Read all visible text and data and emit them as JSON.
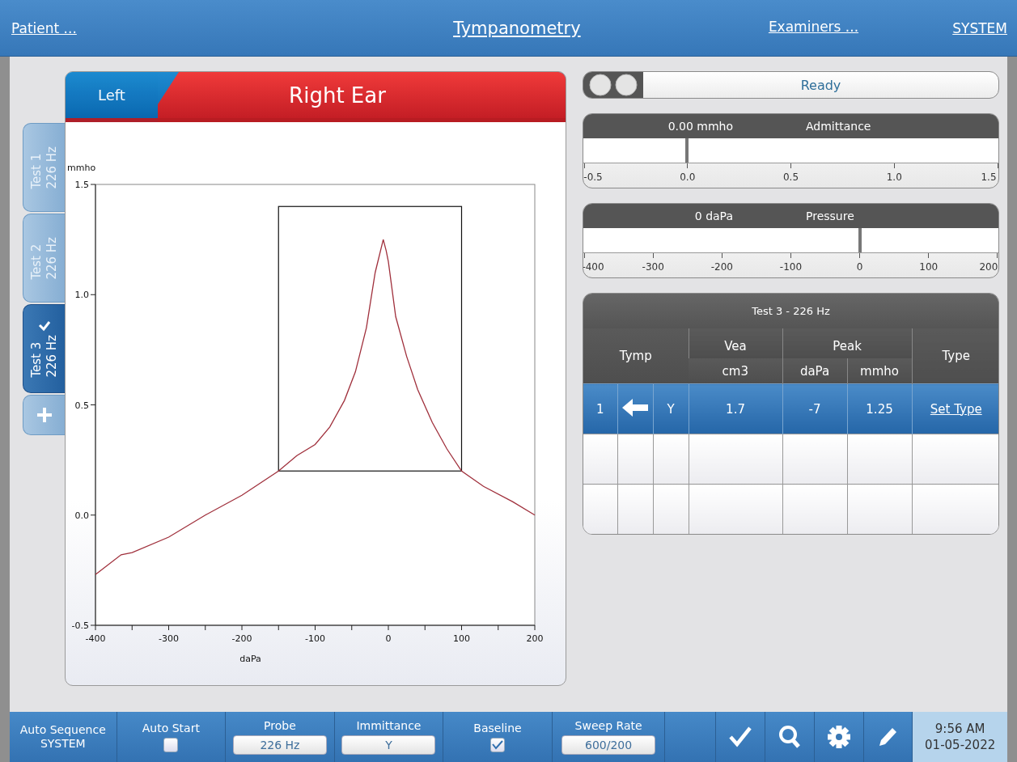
{
  "header": {
    "links": [
      {
        "label": "Patient ...",
        "kind": "side"
      },
      {
        "label": "Tympanometry",
        "kind": "title"
      },
      {
        "label": "Examiners ...",
        "kind": "side"
      },
      {
        "label": "SYSTEM",
        "kind": "side"
      }
    ]
  },
  "ear_tabs": [
    {
      "label": "Left",
      "selected": false
    },
    {
      "label": "Right Ear",
      "selected": true
    }
  ],
  "test_tabs": [
    {
      "label": "Test 1",
      "sublabel": "226 Hz",
      "selected": false,
      "checked": false
    },
    {
      "label": "Test 2",
      "sublabel": "226 Hz",
      "selected": false,
      "checked": false
    },
    {
      "label": "Test 3",
      "sublabel": "226 Hz",
      "selected": true,
      "checked": true
    }
  ],
  "graph": {
    "chart_data": {
      "type": "line",
      "xlabel": "daPa",
      "ylabel": "mmho",
      "xlim": [
        -400,
        200
      ],
      "ylim": [
        -0.5,
        1.5
      ],
      "xticks": [
        -400,
        -300,
        -200,
        -100,
        0,
        100,
        200
      ],
      "yticks": [
        {
          "value": -0.5,
          "label": "-0.5"
        },
        {
          "value": 0,
          "label": "0.0"
        },
        {
          "value": 0.5,
          "label": "0.5"
        },
        {
          "value": 1,
          "label": "1.0"
        },
        {
          "value": 1.5,
          "label": "1.5"
        }
      ],
      "x": [
        -400,
        -365,
        -350,
        -300,
        -250,
        -200,
        -150,
        -125,
        -100,
        -80,
        -60,
        -45,
        -30,
        -18,
        -7,
        -3,
        0,
        10,
        25,
        40,
        60,
        80,
        100,
        130,
        170,
        200
      ],
      "series": [
        {
          "color": "#a0303c",
          "values": [
            -0.27,
            -0.18,
            -0.17,
            -0.1,
            0.0,
            0.09,
            0.2,
            0.27,
            0.32,
            0.4,
            0.52,
            0.65,
            0.85,
            1.1,
            1.25,
            1.2,
            1.15,
            0.9,
            0.72,
            0.57,
            0.42,
            0.3,
            0.2,
            0.13,
            0.06,
            0.0
          ]
        }
      ]
    }
  },
  "status": {
    "text": "Ready"
  },
  "meters": [
    {
      "value": "0.00 mmho",
      "title": "Admittance",
      "level": 0.25,
      "ticks": [
        "-0.5",
        "0.0",
        "0.5",
        "1.0",
        "1.5"
      ]
    },
    {
      "value": "0 daPa",
      "title": "Pressure",
      "level": 0.6667,
      "ticks": [
        "-400",
        "-300",
        "-200",
        "-100",
        "0",
        "100",
        "200"
      ]
    }
  ],
  "results": {
    "title": "Test 3 - 226 Hz",
    "headers": {
      "tymp": "Tymp",
      "vea": "Vea",
      "vea_unit": "cm3",
      "peak": "Peak",
      "peak_dapa": "daPa",
      "peak_mmho": "mmho",
      "type": "Type"
    },
    "rows": [
      {
        "selected": true,
        "number": "1",
        "measure": "Y",
        "vea": "1.7",
        "peak_dapa": "-7",
        "peak_mmho": "1.25",
        "type_link": "Set Type"
      }
    ]
  },
  "toolbar": {
    "items": [
      {
        "kind": "text",
        "label": "Auto Sequence",
        "value": "SYSTEM"
      },
      {
        "kind": "checkbox",
        "label": "Auto Start",
        "checked": false
      },
      {
        "kind": "select",
        "label": "Probe",
        "value": "226 Hz"
      },
      {
        "kind": "select",
        "label": "Immittance",
        "value": "Y"
      },
      {
        "kind": "checkbox",
        "label": "Baseline",
        "checked": true
      },
      {
        "kind": "select",
        "label": "Sweep Rate",
        "value": "600/200"
      },
      {
        "kind": "blank"
      }
    ],
    "clock": {
      "time": "9:56 AM",
      "date": "01-05-2022"
    }
  }
}
